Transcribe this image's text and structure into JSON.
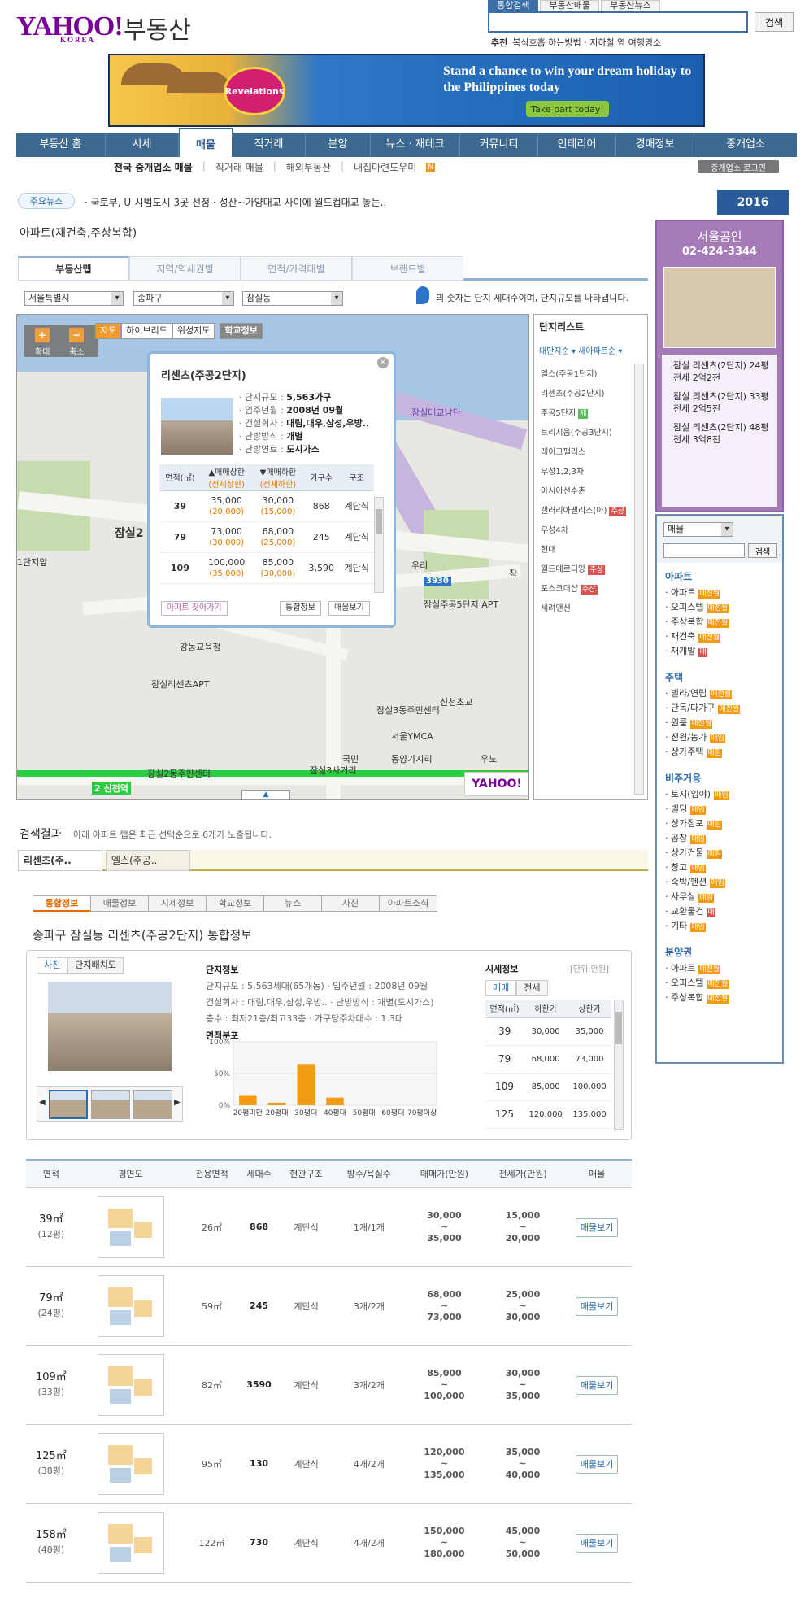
{
  "header": {
    "logo": "YAHOO!",
    "logo_sub": "KOREA",
    "brand": "부동산",
    "search_tabs": [
      "통합검색",
      "부동산매물",
      "부동산뉴스"
    ],
    "search_button": "검색",
    "rec_label": "추천",
    "rec_links": "복식호흡 하는방법 · 지하철 역 여행명소"
  },
  "banner": {
    "brand_mark": "Revelations",
    "text": "Stand a chance to win your dream holiday to the Philippines today",
    "button": "Take part today!"
  },
  "nav": {
    "items": [
      "부동산 홈",
      "시세",
      "매물",
      "직거래",
      "분양",
      "뉴스 · 재테크",
      "커뮤니티",
      "인테리어",
      "경매정보",
      "중개업소"
    ],
    "sub": [
      "전국 중개업소 매물",
      "직거래 매물",
      "해외부동산",
      "내집마련도우미"
    ],
    "agent_login": "중개업소 로그인"
  },
  "news": {
    "label": "주요뉴스",
    "text": "· 국토부, U-시범도시 3곳 선정  · 성산~가양대교 사이에 월드컵대교 놓는..",
    "year_badge": "2016"
  },
  "page_title": "아파트(재건축,주상복합)",
  "tabs": [
    "부동산맵",
    "지역/역세권별",
    "면적/가격대별",
    "브랜드별"
  ],
  "filters": {
    "city": "서울특별시",
    "gu": "송파구",
    "dong": "잠실동"
  },
  "map_note": "의 숫자는 단지 세대수이며, 단지규모를 나타냅니다.",
  "map": {
    "zoom_in": "+",
    "zoom_out": "−",
    "zoom_in_label": "확대",
    "zoom_out_label": "축소",
    "types": [
      "지도",
      "하이브리드",
      "위성지도"
    ],
    "school": "학교정보",
    "labels": [
      "잠실2",
      "1단지앞",
      "잠실대교남단",
      "강동교육청",
      "잠실리센츠APT",
      "우리",
      "잠실주공5단지 APT",
      "잠실3동주민센터",
      "신천초교",
      "서울YMCA",
      "국민",
      "동양가지리",
      "잠실3사거리",
      "잠실2동주민센터",
      "2 신천역",
      "우노",
      "잠",
      "3930"
    ]
  },
  "popup": {
    "title": "리센츠(주공2단지)",
    "info": [
      [
        "단지규모",
        "5,563가구"
      ],
      [
        "입주년월",
        "2008년 09월"
      ],
      [
        "건설회사",
        "대림,대우,삼성,우방.."
      ],
      [
        "난방방식",
        "개별"
      ],
      [
        "난방연료",
        "도시가스"
      ]
    ],
    "headers": [
      "면적(㎡)",
      "▲매매상한",
      "(전세상한)",
      "▼매매하한",
      "(전세하한)",
      "가구수",
      "구조"
    ],
    "rows": [
      [
        "39",
        "35,000",
        "(20,000)",
        "30,000",
        "(15,000)",
        "868",
        "계단식"
      ],
      [
        "79",
        "73,000",
        "(30,000)",
        "68,000",
        "(25,000)",
        "245",
        "계단식"
      ],
      [
        "109",
        "100,000",
        "(35,000)",
        "85,000",
        "(30,000)",
        "3,590",
        "계단식"
      ]
    ],
    "btn_find": "아파트 찾아가기",
    "btn_info": "통합정보",
    "btn_sale": "매물보기"
  },
  "danji": {
    "title": "단지리스트",
    "sort": "대단지순 ▾  새아파트순 ▾",
    "items": [
      {
        "name": "엘스(주공1단지)",
        "tag": ""
      },
      {
        "name": "리센츠(주공2단지)",
        "tag": ""
      },
      {
        "name": "주공5단지",
        "tag": "재"
      },
      {
        "name": "트리지움(주공3단지)",
        "tag": ""
      },
      {
        "name": "레이크팰리스",
        "tag": ""
      },
      {
        "name": "우성1,2,3차",
        "tag": ""
      },
      {
        "name": "아시아선수촌",
        "tag": ""
      },
      {
        "name": "갤러리아팰리스(아)",
        "tag": "주상"
      },
      {
        "name": "우성4차",
        "tag": ""
      },
      {
        "name": "현대",
        "tag": ""
      },
      {
        "name": "월드메르디앙",
        "tag": "주상"
      },
      {
        "name": "포스코더샵",
        "tag": "주상"
      },
      {
        "name": "세려맨션",
        "tag": ""
      }
    ]
  },
  "agent": {
    "name": "서울공인",
    "phone": "02-424-3344",
    "listings": [
      "잠실 리센츠(2단지) 24평 전세 2억2천",
      "잠실 리센츠(2단지) 33평 전세 2억5천",
      "잠실 리센츠(2단지) 48평 전세 3억8천"
    ]
  },
  "side_search": {
    "select": "매물",
    "button": "검색",
    "groups": [
      {
        "title": "아파트",
        "items": [
          [
            "아파트",
            "매전월"
          ],
          [
            "오피스텔",
            "매전월"
          ],
          [
            "주상복합",
            "매전월"
          ],
          [
            "재건축",
            "매전월"
          ],
          [
            "재개발",
            "매"
          ]
        ]
      },
      {
        "title": "주택",
        "items": [
          [
            "빌라/연립",
            "매전월"
          ],
          [
            "단독/다가구",
            "매전월"
          ],
          [
            "원룸",
            "매전월"
          ],
          [
            "전원/농가",
            "매임"
          ],
          [
            "상가주택",
            "매임"
          ]
        ]
      },
      {
        "title": "비주거용",
        "items": [
          [
            "토지(임야)",
            "매임"
          ],
          [
            "빌딩",
            "매임"
          ],
          [
            "상가점포",
            "매임"
          ],
          [
            "공장",
            "매임"
          ],
          [
            "상가건물",
            "매임"
          ],
          [
            "창고",
            "매임"
          ],
          [
            "숙박/펜션",
            "매임"
          ],
          [
            "사무실",
            "매임"
          ],
          [
            "교환물건",
            "매"
          ],
          [
            "기타",
            "매임"
          ]
        ]
      },
      {
        "title": "분양권",
        "items": [
          [
            "아파트",
            "매전월"
          ],
          [
            "오피스텔",
            "매전월"
          ],
          [
            "주상복합",
            "매전월"
          ]
        ]
      }
    ]
  },
  "results": {
    "title": "검색결과",
    "note": "아래 아파트 탭은 최근 선택순으로 6개가 노출됩니다.",
    "tabs": [
      "리센츠(주..",
      "엘스(주공.."
    ],
    "info_tabs": [
      "통합정보",
      "매물정보",
      "시세정보",
      "학교정보",
      "뉴스",
      "사진",
      "아파트소식"
    ],
    "info_title": "송파구 잠실동 리센츠(주공2단지) 통합정보",
    "photo_tabs": [
      "사진",
      "단지배치도"
    ],
    "danji_label": "단지정보",
    "danji_info": [
      "단지규모 : 5,563세대(65개동) · 입주년월 : 2008년 09월",
      "건설회사 : 대림,대우,삼성,우방..  · 난방방식 : 개별(도시가스)",
      "층수 : 최저21층/최고33층  · 가구당주차대수 : 1.3대"
    ],
    "area_label": "면적분포",
    "price_label": "시세정보",
    "price_unit": "[단위:만원]",
    "price_tabs": [
      "매매",
      "전세"
    ],
    "price_headers": [
      "면적(㎡)",
      "하한가",
      "상한가"
    ],
    "price_rows": [
      [
        "39",
        "30,000",
        "35,000"
      ],
      [
        "79",
        "68,000",
        "73,000"
      ],
      [
        "109",
        "85,000",
        "100,000"
      ],
      [
        "125",
        "120,000",
        "135,000"
      ]
    ]
  },
  "chart_data": {
    "type": "bar",
    "categories": [
      "20평미만",
      "20평대",
      "30평대",
      "40평대",
      "50평대",
      "60평대",
      "70평이상"
    ],
    "values": [
      16,
      4,
      65,
      12,
      0,
      0,
      0
    ],
    "ylim": [
      0,
      100
    ],
    "yticks": [
      "100%",
      "50%",
      "0%"
    ],
    "bar_color": "#f39c12"
  },
  "table": {
    "headers": [
      "면적",
      "평면도",
      "전용면적",
      "세대수",
      "현관구조",
      "방수/욕실수",
      "매매가(만원)",
      "전세가(만원)",
      "매물"
    ],
    "rows": [
      {
        "area": "39㎡",
        "pyeong": "(12평)",
        "excl": "26㎡",
        "units": "868",
        "entry": "계단식",
        "rooms": "1개/1개",
        "sale_lo": "30,000",
        "sale_hi": "35,000",
        "rent_lo": "15,000",
        "rent_hi": "20,000",
        "btn": "매물보기"
      },
      {
        "area": "79㎡",
        "pyeong": "(24평)",
        "excl": "59㎡",
        "units": "245",
        "entry": "계단식",
        "rooms": "3개/2개",
        "sale_lo": "68,000",
        "sale_hi": "73,000",
        "rent_lo": "25,000",
        "rent_hi": "30,000",
        "btn": "매물보기"
      },
      {
        "area": "109㎡",
        "pyeong": "(33평)",
        "excl": "82㎡",
        "units": "3590",
        "entry": "계단식",
        "rooms": "3개/2개",
        "sale_lo": "85,000",
        "sale_hi": "100,000",
        "rent_lo": "30,000",
        "rent_hi": "35,000",
        "btn": "매물보기"
      },
      {
        "area": "125㎡",
        "pyeong": "(38평)",
        "excl": "95㎡",
        "units": "130",
        "entry": "계단식",
        "rooms": "4개/2개",
        "sale_lo": "120,000",
        "sale_hi": "135,000",
        "rent_lo": "35,000",
        "rent_hi": "40,000",
        "btn": "매물보기"
      },
      {
        "area": "158㎡",
        "pyeong": "(48평)",
        "excl": "122㎡",
        "units": "730",
        "entry": "계단식",
        "rooms": "4개/2개",
        "sale_lo": "150,000",
        "sale_hi": "180,000",
        "rent_lo": "45,000",
        "rent_hi": "50,000",
        "btn": "매물보기"
      }
    ]
  }
}
